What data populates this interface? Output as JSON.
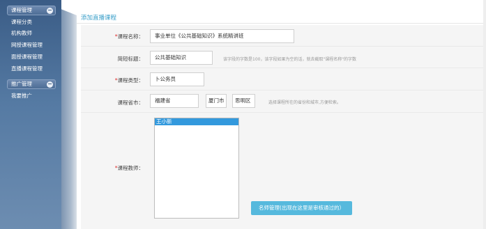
{
  "sidebar": {
    "groups": [
      {
        "label": "课程管理",
        "toggle": "−",
        "items": [
          {
            "label": "课程分类"
          },
          {
            "label": "机构教师"
          },
          {
            "label": "网授课程管理"
          },
          {
            "label": "面授课程管理"
          },
          {
            "label": "直播课程管理"
          }
        ]
      },
      {
        "label": "推广管理",
        "toggle": "−",
        "items": [
          {
            "label": "我要推广"
          }
        ]
      }
    ]
  },
  "page": {
    "title": "添加直播课程"
  },
  "form": {
    "course_name": {
      "required_mark": "*",
      "label": "课程名称：",
      "value": "事业单位《公共基础知识》系统精讲班"
    },
    "short_title": {
      "label": "简短标题：",
      "value": "公共基础知识",
      "hint": "该字段的字数是100，该字段如果为空的话，就去截取\"课程名称\"的字数"
    },
    "course_type": {
      "required_mark": "*",
      "label": "课程类型：",
      "value": "卜公务员"
    },
    "course_city": {
      "label": "课程省市：",
      "province": "福建省",
      "city": "厦门市",
      "district": "思明区",
      "hint": "选择课程所在的省份和城市,方便检索。"
    },
    "course_teacher": {
      "required_mark": "*",
      "label": "课程教师：",
      "options": [
        "王小新"
      ],
      "selected": "王小新"
    },
    "manage_button": "名师管理(出现在这里是审核通过的）"
  },
  "colors": {
    "sidebar": "#4a6c95",
    "accent": "#3a9fc9",
    "button": "#56b9dd",
    "required": "#e03030",
    "selection": "#3399dd"
  }
}
